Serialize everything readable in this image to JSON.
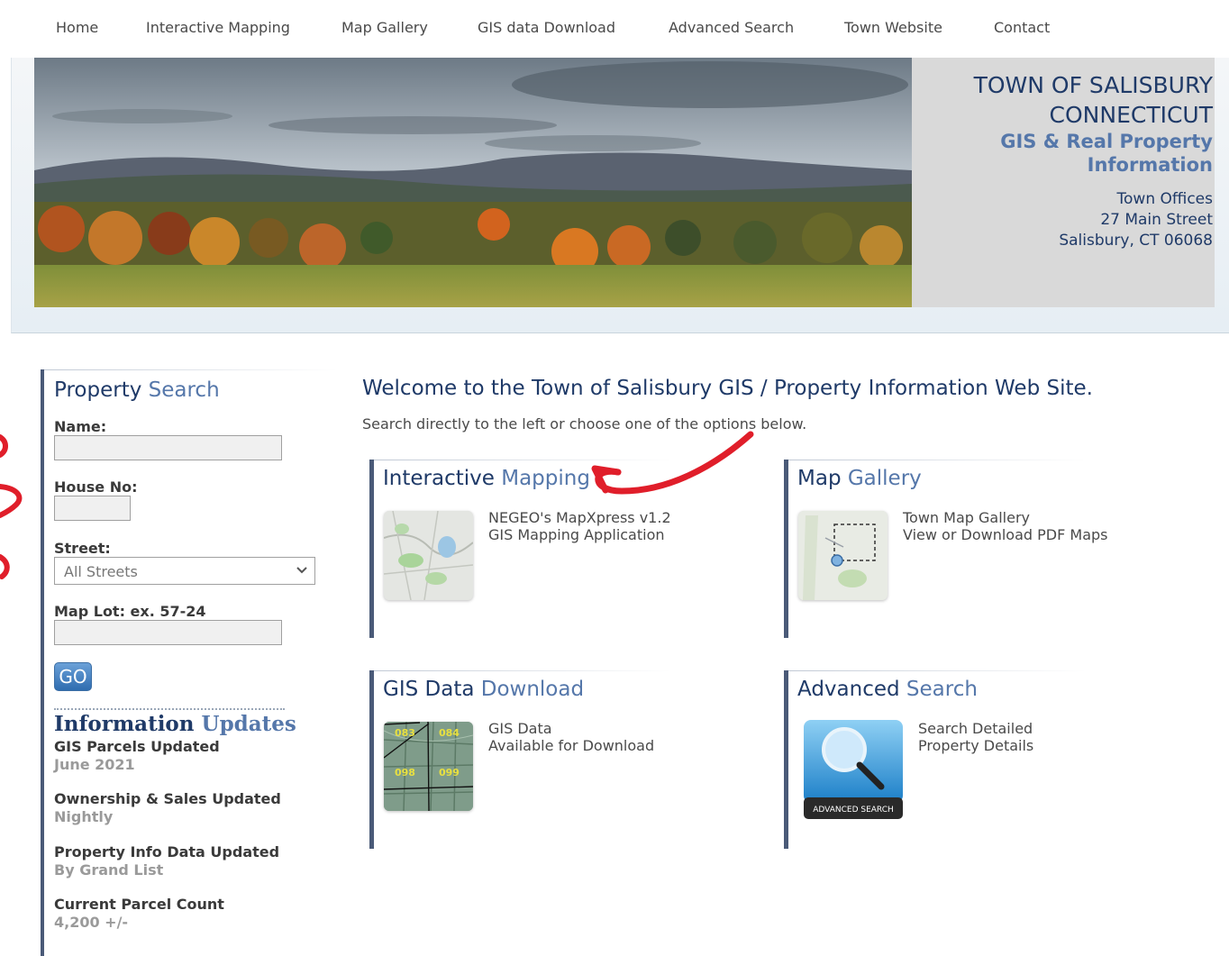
{
  "nav": {
    "items": [
      "Home",
      "Interactive Mapping",
      "Map Gallery",
      "GIS data Download",
      "Advanced Search",
      "Town Website",
      "Contact"
    ]
  },
  "header": {
    "town_line1": "TOWN OF SALISBURY",
    "town_line2": "CONNECTICUT",
    "subtitle_line1": "GIS & Real Property",
    "subtitle_line2": "Information",
    "address_line1": "Town Offices",
    "address_line2": "27 Main Street",
    "address_line3": "Salisbury, CT 06068"
  },
  "property_search": {
    "title_part1": "Property ",
    "title_part2": "Search",
    "name_label": "Name:",
    "name_value": "",
    "house_label": "House No:",
    "house_value": "",
    "street_label": "Street:",
    "street_selected": "All Streets",
    "maplot_label": "Map Lot: ex. 57-24",
    "maplot_value": "",
    "go_label": "GO"
  },
  "info_updates": {
    "title_part1": "Information ",
    "title_part2": "Updates",
    "items": [
      {
        "key": "GIS Parcels Updated",
        "value": "June 2021"
      },
      {
        "key": "Ownership & Sales Updated",
        "value": "Nightly"
      },
      {
        "key": "Property Info Data Updated",
        "value": "By Grand List"
      },
      {
        "key": "Current Parcel Count",
        "value": "4,200 +/-"
      }
    ]
  },
  "main": {
    "welcome": "Welcome to the Town of Salisbury GIS / Property Information Web Site.",
    "subtext": "Search directly to the left or choose one of the options below.",
    "cards": [
      {
        "title_a": "Interactive ",
        "title_b": "Mapping",
        "line1": "NEGEO's MapXpress v1.2",
        "line2": "GIS Mapping Application"
      },
      {
        "title_a": "Map ",
        "title_b": "Gallery",
        "line1": "Town Map Gallery",
        "line2": "View or Download PDF Maps"
      },
      {
        "title_a": "GIS Data ",
        "title_b": "Download",
        "line1": "GIS Data",
        "line2": "Available for Download"
      },
      {
        "title_a": "Advanced ",
        "title_b": "Search",
        "line1": "Search Detailed",
        "line2": "Property Details"
      }
    ],
    "thumb_text": {
      "grid_labels": [
        "083",
        "084",
        "098",
        "099"
      ],
      "adv_label": "ADVANCED SEARCH"
    }
  },
  "colors": {
    "navy": "#1f3a68",
    "accent_blue": "#5577aa",
    "annotation_red": "#e01e2a"
  }
}
